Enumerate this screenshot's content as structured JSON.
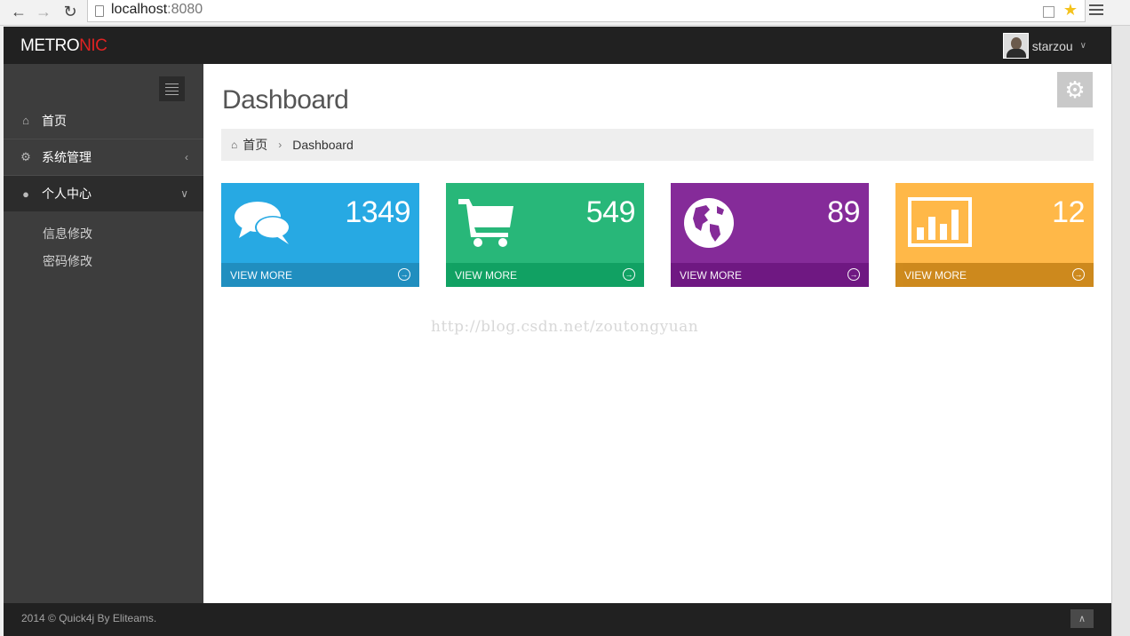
{
  "browser": {
    "url_host": "localhost",
    "url_port": ":8080"
  },
  "header": {
    "logo_part1": "METRO",
    "logo_part2": "NIC",
    "username": "starzou"
  },
  "sidebar": {
    "items": [
      {
        "label": "首页",
        "icon": "home-icon"
      },
      {
        "label": "系统管理",
        "icon": "cogs-icon"
      },
      {
        "label": "个人中心",
        "icon": "user-icon"
      }
    ],
    "sub_items": [
      {
        "label": "信息修改"
      },
      {
        "label": "密码修改"
      }
    ]
  },
  "main": {
    "title": "Dashboard",
    "breadcrumb": {
      "home": "首页",
      "current": "Dashboard"
    },
    "tiles": [
      {
        "value": "1349",
        "more": "VIEW MORE",
        "color": "#27a9e3",
        "icon": "comments-icon"
      },
      {
        "value": "549",
        "more": "VIEW MORE",
        "color": "#28b779",
        "icon": "shopping-cart-icon"
      },
      {
        "value": "89",
        "more": "VIEW MORE",
        "color": "#852b99",
        "icon": "globe-icon"
      },
      {
        "value": "12",
        "more": "VIEW MORE",
        "color": "#ffb848",
        "icon": "bar-chart-icon"
      }
    ]
  },
  "watermark": "http://blog.csdn.net/zoutongyuan",
  "footer": {
    "text": "2014 © Quick4j By Eliteams."
  },
  "colors": {
    "topbar": "#212121",
    "sidebar": "#3d3d3d",
    "logo_accent": "#e02222"
  }
}
